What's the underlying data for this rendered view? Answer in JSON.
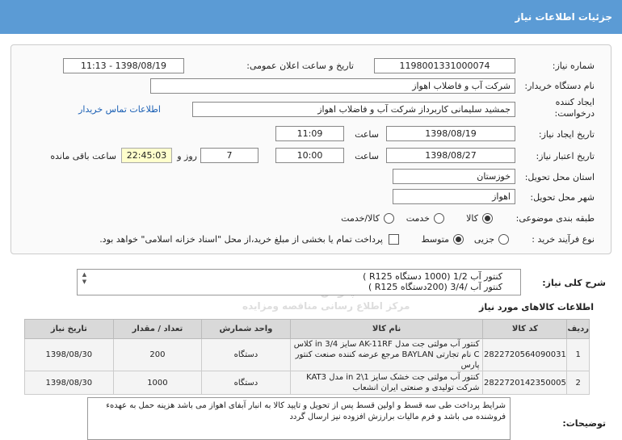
{
  "header": {
    "title": "جزئیات اطلاعات نیاز"
  },
  "fields": {
    "need_number_label": "شماره نیاز:",
    "need_number": "1198001331000074",
    "announce_label": "تاریخ و ساعت اعلان عمومی:",
    "announce_value": "1398/08/19 - 11:13",
    "buyer_label": "نام دستگاه خریدار:",
    "buyer_value": "شرکت آب و فاضلاب اهواز",
    "creator_label_1": "ایجاد کننده",
    "creator_label_2": "درخواست:",
    "creator_value": "جمشید سلیمانی کاربرداز شرکت آب و فاضلاب اهواز",
    "contact_link": "اطلاعات تماس خریدار",
    "create_date_label": "تاریخ ایجاد نیاز:",
    "create_date": "1398/08/19",
    "time_label": "ساعت",
    "create_time": "11:09",
    "validity_label": "تاریخ اعتبار نیاز:",
    "validity_date": "1398/08/27",
    "validity_time": "10:00",
    "days_value": "7",
    "days_label": "روز و",
    "remaining_time": "22:45:03",
    "remaining_label": "ساعت باقی مانده",
    "province_label": "استان محل تحویل:",
    "province_value": "خوزستان",
    "city_label": "شهر محل تحویل:",
    "city_value": "اهواز",
    "category_label": "طبقه بندی موضوعی:",
    "cat_goods": "کالا",
    "cat_service": "خدمت",
    "cat_goods_service": "کالا/خدمت",
    "process_label": "نوع فرآیند خرید :",
    "proc_minor": "جزیی",
    "proc_medium": "متوسط",
    "payment_text": "پرداخت تمام یا بخشی از مبلغ خرید،از محل \"اسناد خزانه اسلامی\" خواهد بود.",
    "desc_label": "شرح کلی نیاز:",
    "desc_line1": "کنتور آب 1/2 (1000 دستگاه R125 )",
    "desc_line2": "کنتور آب /3/4 (200دستگاه R125 )",
    "goods_info_title": "اطلاعات کالاهای مورد نیاز",
    "notes_label": "توضیحات:",
    "notes_text": "شرایط پرداخت طی سه قسط و اولین قسط پس از تحویل و تایید کالا به انبار آبفای اهواز می باشد هزینه حمل به عهدهء فروشنده می باشد و فرم مالیات برارزش افزوده نیز ارسال گردد"
  },
  "watermark": {
    "line1": "ParsNamadData",
    "line2": "اطلاعات پارس نماد داده ها",
    "line3": "مرکز اطلاع رسانی مناقصه ومزایده"
  },
  "table": {
    "headers": [
      "ردیف",
      "کد کالا",
      "نام کالا",
      "واحد شمارش",
      "تعداد / مقدار",
      "تاریخ نیاز"
    ],
    "rows": [
      [
        "1",
        "2822720564090031",
        "کنتور آب مولتی جت مدل AK-11RF سایز 3/4 in کلاس C نام تجارتی BAYLAN مرجع عرضه کننده صنعت کنتور پارس",
        "دستگاه",
        "200",
        "1398/08/30"
      ],
      [
        "2",
        "2822720142350005",
        "کنتور آب مولتی جت خشک سایز 1\\2 in مدل KAT3 شرکت تولیدی و صنعتی ایران انشعاب",
        "دستگاه",
        "1000",
        "1398/08/30"
      ]
    ]
  }
}
